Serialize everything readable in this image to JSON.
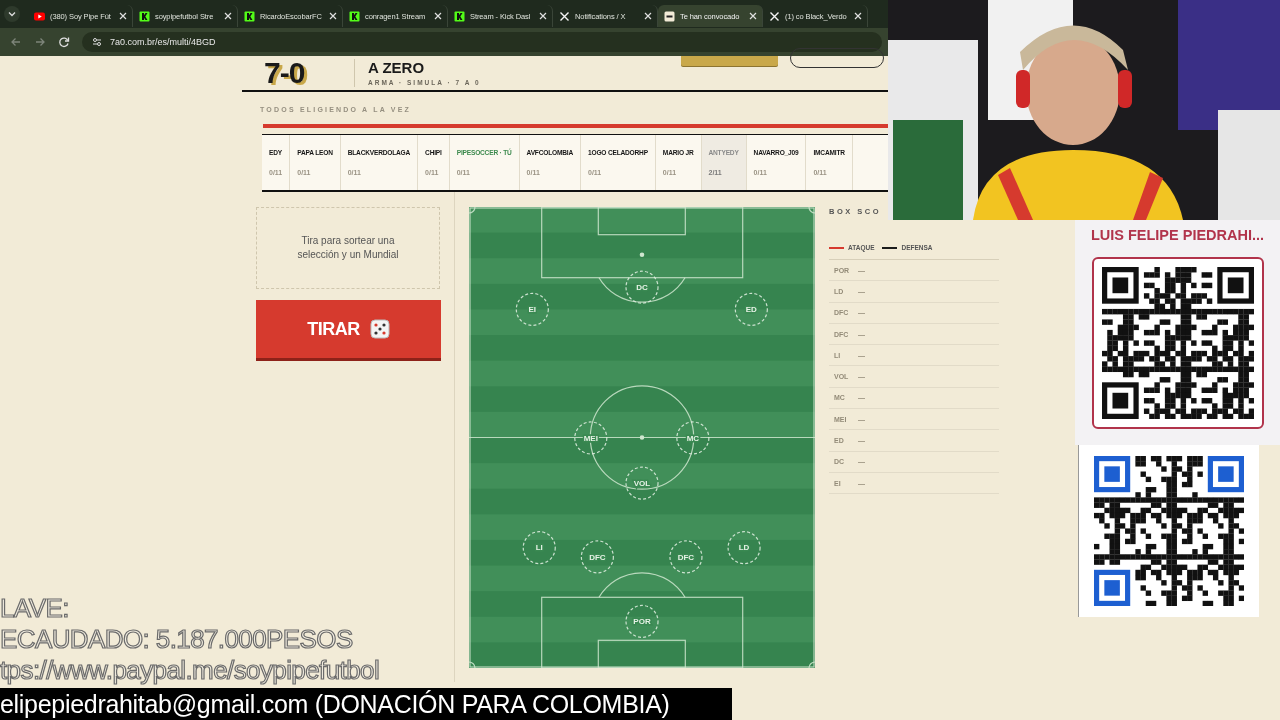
{
  "browser": {
    "tabs": [
      {
        "title": "(380) Soy Pipe Fút",
        "kind": "video",
        "selected": false
      },
      {
        "title": "soypipefutbol Stre",
        "kind": "stream",
        "selected": false
      },
      {
        "title": "RicardoEscobarFC",
        "kind": "stream",
        "selected": false
      },
      {
        "title": "conragen1 Stream",
        "kind": "stream",
        "selected": false
      },
      {
        "title": "Stream - Kick Dasl",
        "kind": "stream",
        "selected": false
      },
      {
        "title": "Notifications / X",
        "kind": "social",
        "selected": false
      },
      {
        "title": "Te han convocado",
        "kind": "game",
        "selected": true
      },
      {
        "title": "(1) co Black_Verdo",
        "kind": "social",
        "selected": false
      }
    ],
    "address": "7a0.com.br/es/multi/4BGD"
  },
  "header": {
    "logo": "7-0",
    "title": "A ZERO",
    "tagline": "ARMA · SIMULA · 7 A 0"
  },
  "section_label": "TODOS ELIGIENDO A LA VEZ",
  "players": [
    {
      "name": "EDY",
      "score": "0/11",
      "is_you": false,
      "dimmed": false
    },
    {
      "name": "PAPA LEON",
      "score": "0/11",
      "is_you": false,
      "dimmed": false
    },
    {
      "name": "BLACKVERDOLAGA",
      "score": "0/11",
      "is_you": false,
      "dimmed": false
    },
    {
      "name": "CHIPI",
      "score": "0/11",
      "is_you": false,
      "dimmed": false
    },
    {
      "name": "PIPESOCCER · TÚ",
      "score": "0/11",
      "is_you": true,
      "dimmed": false
    },
    {
      "name": "AVFCOLOMBIA",
      "score": "0/11",
      "is_you": false,
      "dimmed": false
    },
    {
      "name": "1OGO CELADORHP",
      "score": "0/11",
      "is_you": false,
      "dimmed": false
    },
    {
      "name": "MARIO JR",
      "score": "0/11",
      "is_you": false,
      "dimmed": false
    },
    {
      "name": "ANTYEDY",
      "score": "2/11",
      "is_you": false,
      "dimmed": true
    },
    {
      "name": "NAVARRO_J09",
      "score": "0/11",
      "is_you": false,
      "dimmed": false
    },
    {
      "name": "IMCAMITR",
      "score": "0/11",
      "is_you": false,
      "dimmed": false
    }
  ],
  "draw_panel": {
    "hint": "Tira para sortear una selección y un Mundial",
    "button": "TIRAR"
  },
  "pitch": {
    "positions": [
      "DC",
      "EI",
      "ED",
      "MEI",
      "MC",
      "VOL",
      "LI",
      "DFC",
      "DFC",
      "LD",
      "POR"
    ]
  },
  "box_score": {
    "title": "BOX SCO",
    "legend": [
      {
        "label": "ATAQUE",
        "color": "#d63a2e"
      },
      {
        "label": "DEFENSA",
        "color": "#1c1c1c"
      }
    ],
    "rows": [
      {
        "position": "POR",
        "value": "—"
      },
      {
        "position": "LD",
        "value": "—"
      },
      {
        "position": "DFC",
        "value": "—"
      },
      {
        "position": "DFC",
        "value": "—"
      },
      {
        "position": "LI",
        "value": "—"
      },
      {
        "position": "VOL",
        "value": "—"
      },
      {
        "position": "MC",
        "value": "—"
      },
      {
        "position": "MEI",
        "value": "—"
      },
      {
        "position": "ED",
        "value": "—"
      },
      {
        "position": "DC",
        "value": "—"
      },
      {
        "position": "EI",
        "value": "—"
      }
    ]
  },
  "stream_overlay": {
    "streamer_name": "LUIS FELIPE PIEDRAHI...",
    "donation_lines": [
      "LAVE:",
      "ECAUDADO: 5.187.000PESOS",
      "tps://www.paypal.me/soypipefutbol"
    ],
    "email_banner": "elipepiedrahitab@gmail.com (DONACIÓN PARA COLOMBIA)"
  }
}
